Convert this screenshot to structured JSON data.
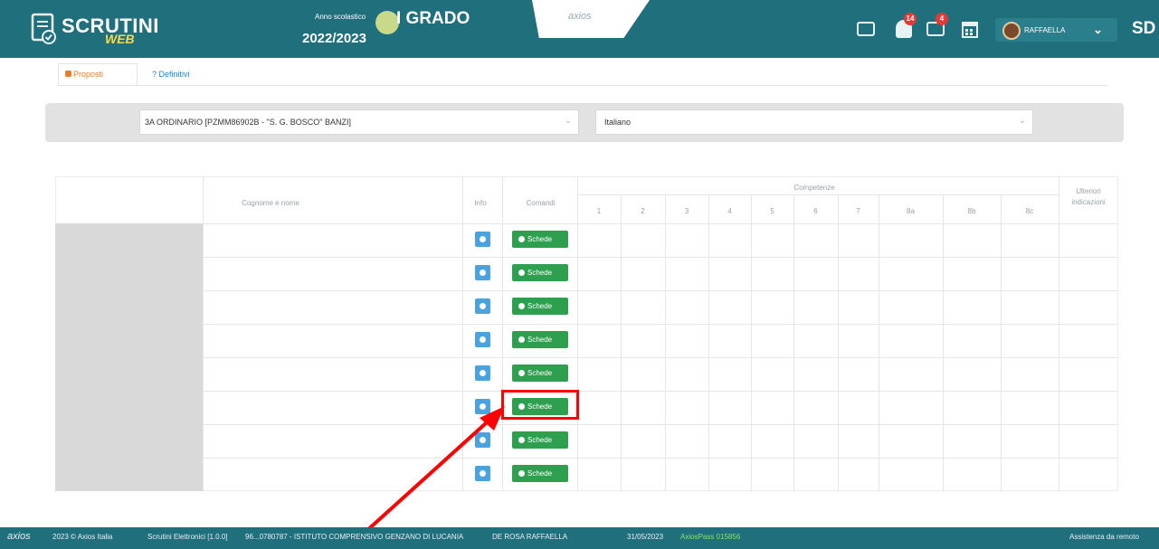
{
  "header": {
    "app_name": "SCRUTINI",
    "app_sub": "WEB",
    "year_label": "Anno scolastico",
    "year_value": "2022/2023",
    "grado": "I GRADO",
    "brand": "axios",
    "user_name": "RAFFAELLA",
    "initials": "SD",
    "badge_alerts": "14",
    "badge_messages": "4"
  },
  "tabs": [
    {
      "label": "Proposti",
      "active": true
    },
    {
      "label": "? Definitivi",
      "active": false
    }
  ],
  "filters": {
    "class_select": "3A ORDINARIO [PZMM86902B - \"S. G. BOSCO\" BANZI]",
    "subject_select": "Italiano"
  },
  "table": {
    "col_name": "Cognome e nome",
    "col_info": "Info",
    "col_comandi": "Comandi",
    "group_competenze": "Competenze",
    "competenze": [
      "1",
      "2",
      "3",
      "4",
      "5",
      "6",
      "7",
      "8a",
      "8b",
      "8c"
    ],
    "col_ulteriori": "Ulteriori indicazioni",
    "button_label": "Schede",
    "rows": 8
  },
  "footer": {
    "brand": "axios",
    "copyright": "2023 © Axios Italia",
    "app": "Scrutini Elettronici [1.0.0]",
    "school": "96...0780787 - ISTITUTO COMPRENSIVO GENZANO DI LUCANIA",
    "user": "DE ROSA RAFFAELLA",
    "date": "31/05/2023",
    "pass": "AxiosPass 015856",
    "assist": "Assistenza da remoto"
  },
  "colors": {
    "header": "#1f6f7d",
    "button_green": "#2e9e4f",
    "info_blue": "#4aa3df",
    "annotation_red": "#ff0000"
  }
}
